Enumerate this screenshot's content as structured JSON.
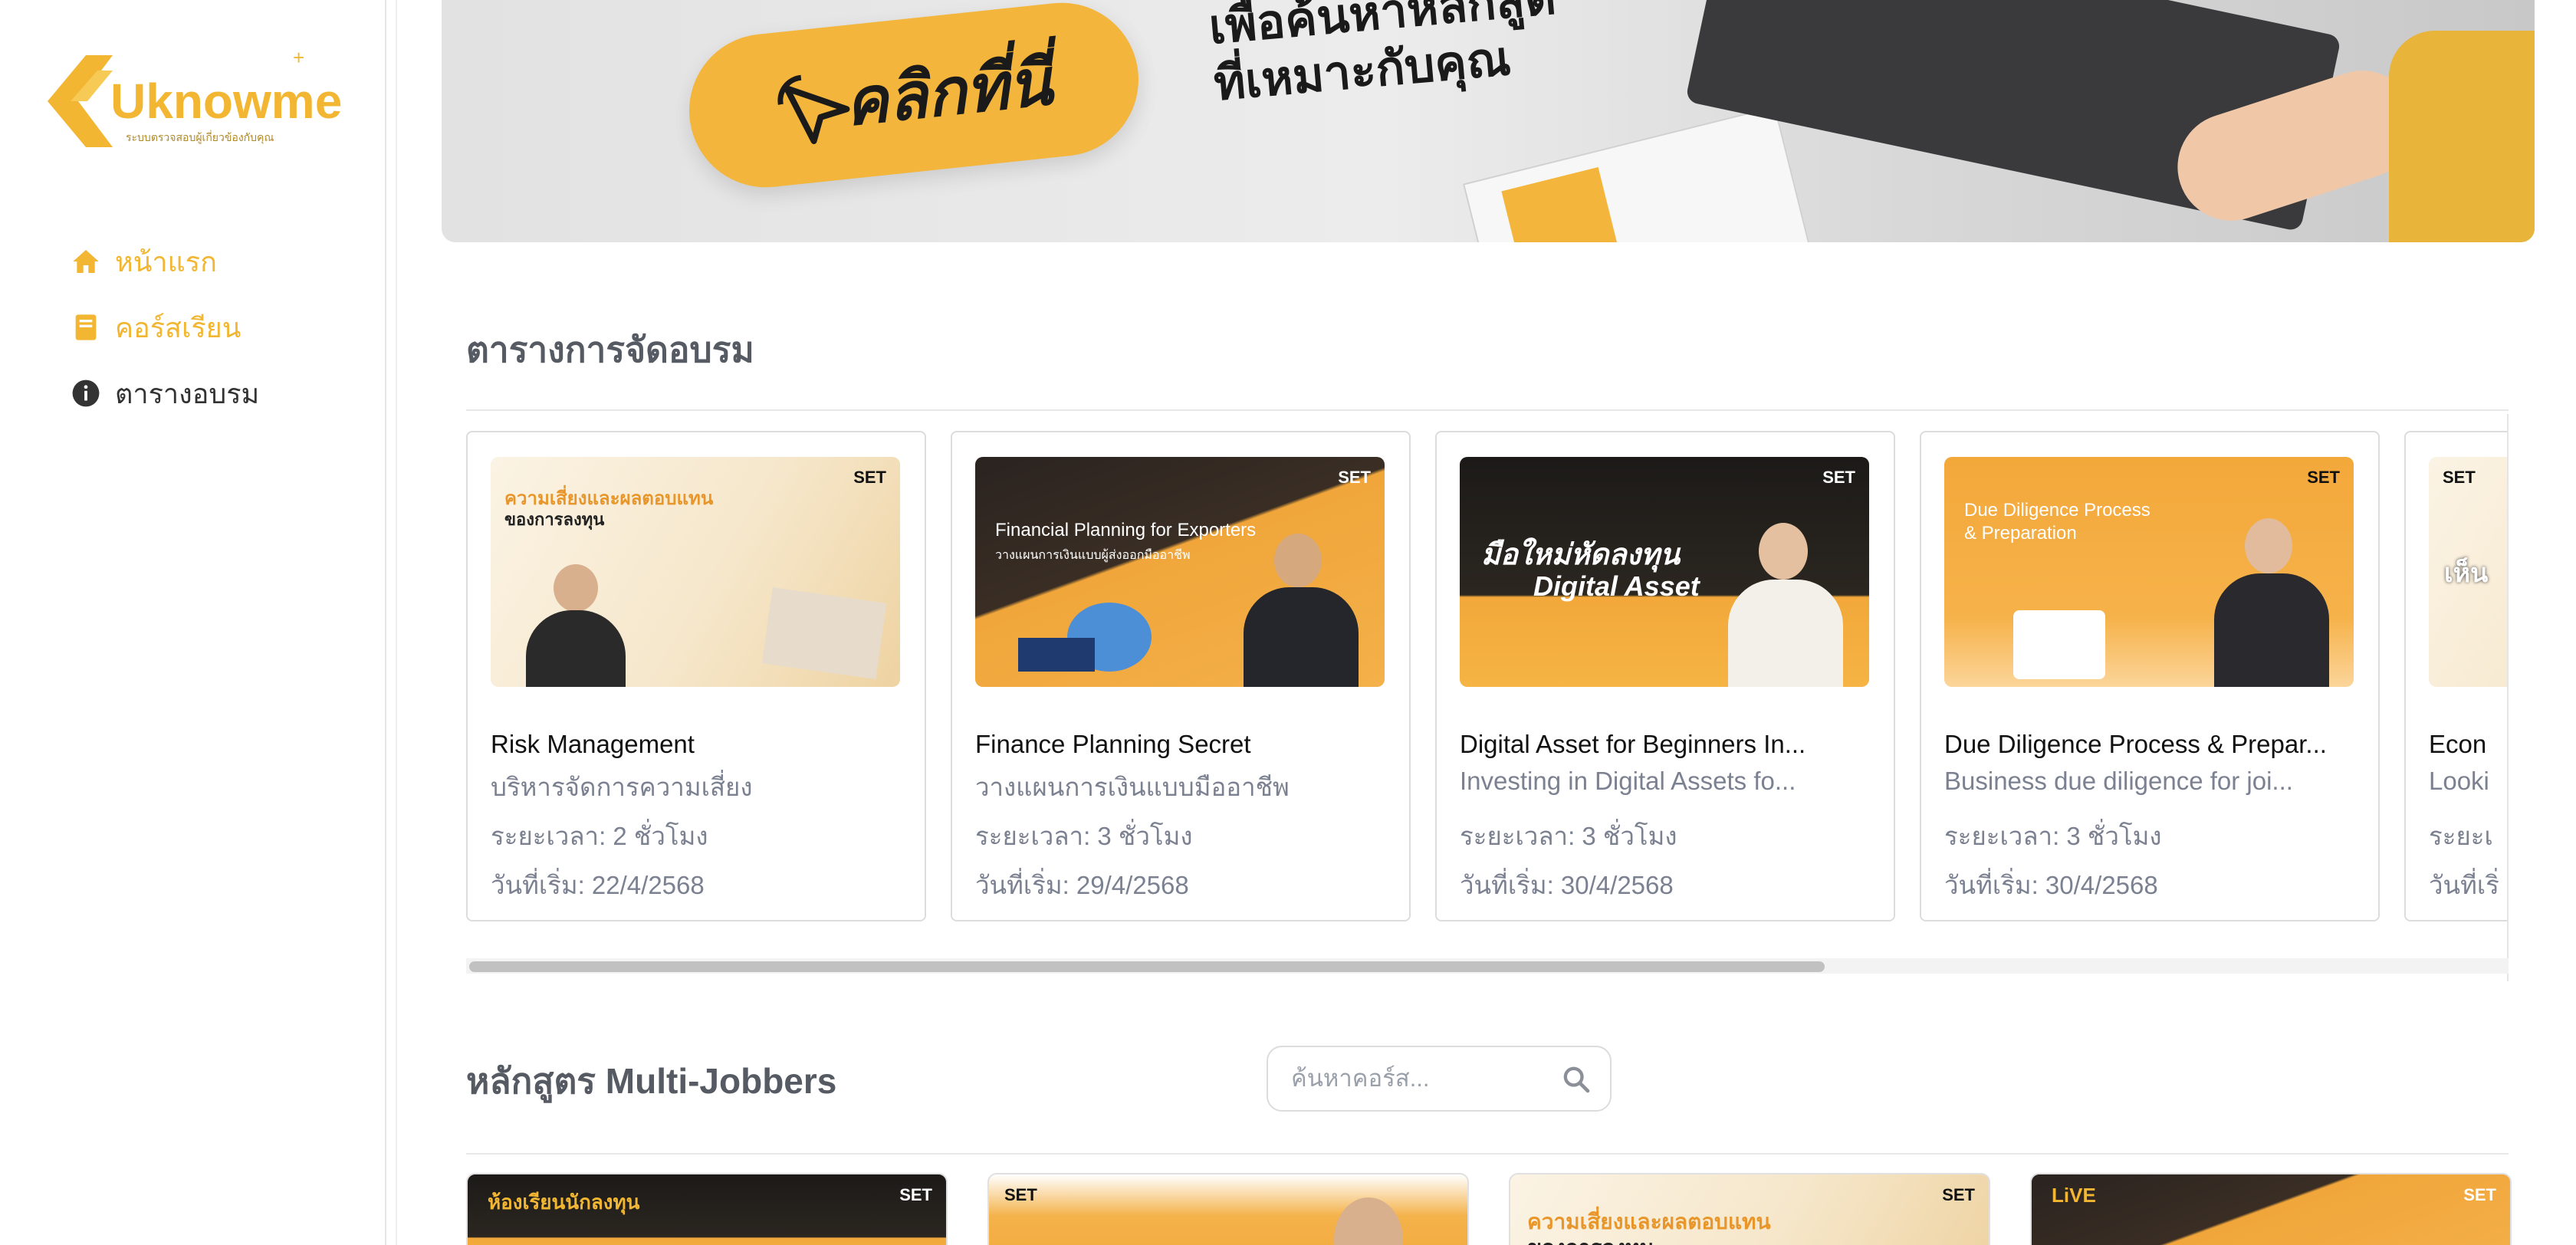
{
  "brand": {
    "name": "Uknowme",
    "tagline": "ระบบตรวจสอบผู้เกี่ยวข้องกับคุณ",
    "accent": "#f2b632"
  },
  "sidebar": {
    "items": [
      {
        "label": "หน้าแรก",
        "icon": "home-icon",
        "active": true
      },
      {
        "label": "คอร์สเรียน",
        "icon": "book-icon",
        "active": true
      },
      {
        "label": "ตารางอบรม",
        "icon": "info-icon",
        "active": false
      }
    ]
  },
  "banner": {
    "cta_label": "คลิกที่นี่",
    "tagline_line1": "เพื่อค้นหาหลักสูต",
    "tagline_line2": "ที่เหมาะกับคุณ"
  },
  "schedule": {
    "title": "ตารางการจัดอบรม",
    "cards": [
      {
        "title": "Risk Management",
        "subtitle": "บริหารจัดการความเสี่ยง",
        "duration": "ระยะเวลา: 2 ชั่วโมง",
        "start": "วันที่เริ่ม: 22/4/2568",
        "thumb_heading": "ความเสี่ยงและผลตอบแทน",
        "thumb_sub": "ของการลงทุน",
        "thumb_logo": "SET"
      },
      {
        "title": "Finance Planning Secret",
        "subtitle": "วางแผนการเงินแบบมืออาชีพ",
        "duration": "ระยะเวลา: 3 ชั่วโมง",
        "start": "วันที่เริ่ม: 29/4/2568",
        "thumb_heading": "Financial Planning for Exporters",
        "thumb_sub": "วางแผนการเงินแบบผู้ส่งออกมืออาชีพ",
        "thumb_logo": "SET"
      },
      {
        "title": "Digital Asset for Beginners In...",
        "subtitle": "Investing in Digital Assets fo...",
        "duration": "ระยะเวลา: 3 ชั่วโมง",
        "start": "วันที่เริ่ม: 30/4/2568",
        "thumb_heading": "มือใหม่หัดลงทุน",
        "thumb_sub": "Digital Asset",
        "thumb_logo": "SET"
      },
      {
        "title": "Due Diligence Process & Prepar...",
        "subtitle": "Business due diligence for joi...",
        "duration": "ระยะเวลา: 3 ชั่วโมง",
        "start": "วันที่เริ่ม: 30/4/2568",
        "thumb_heading": "Due Diligence Process",
        "thumb_sub": "& Preparation",
        "thumb_logo": "SET"
      },
      {
        "title": "Econ",
        "subtitle": "Looki",
        "duration": "ระยะเ",
        "start": "วันที่เริ่",
        "thumb_heading": "เห็น",
        "thumb_sub": "",
        "thumb_logo": "SET"
      }
    ]
  },
  "multi_jobbers": {
    "title": "หลักสูตร Multi-Jobbers",
    "search_placeholder": "ค้นหาคอร์ส...",
    "cards": [
      {
        "thumb_heading": "ห้องเรียนนักลงทุน",
        "thumb_logo": "SET"
      },
      {
        "thumb_heading": "",
        "thumb_logo": "SET"
      },
      {
        "thumb_heading": "ความเสี่ยงและผลตอบแทน",
        "thumb_sub": "ของการลงทุน",
        "thumb_logo": "SET"
      },
      {
        "thumb_heading": "LiVE",
        "thumb_logo": "SET"
      }
    ]
  }
}
